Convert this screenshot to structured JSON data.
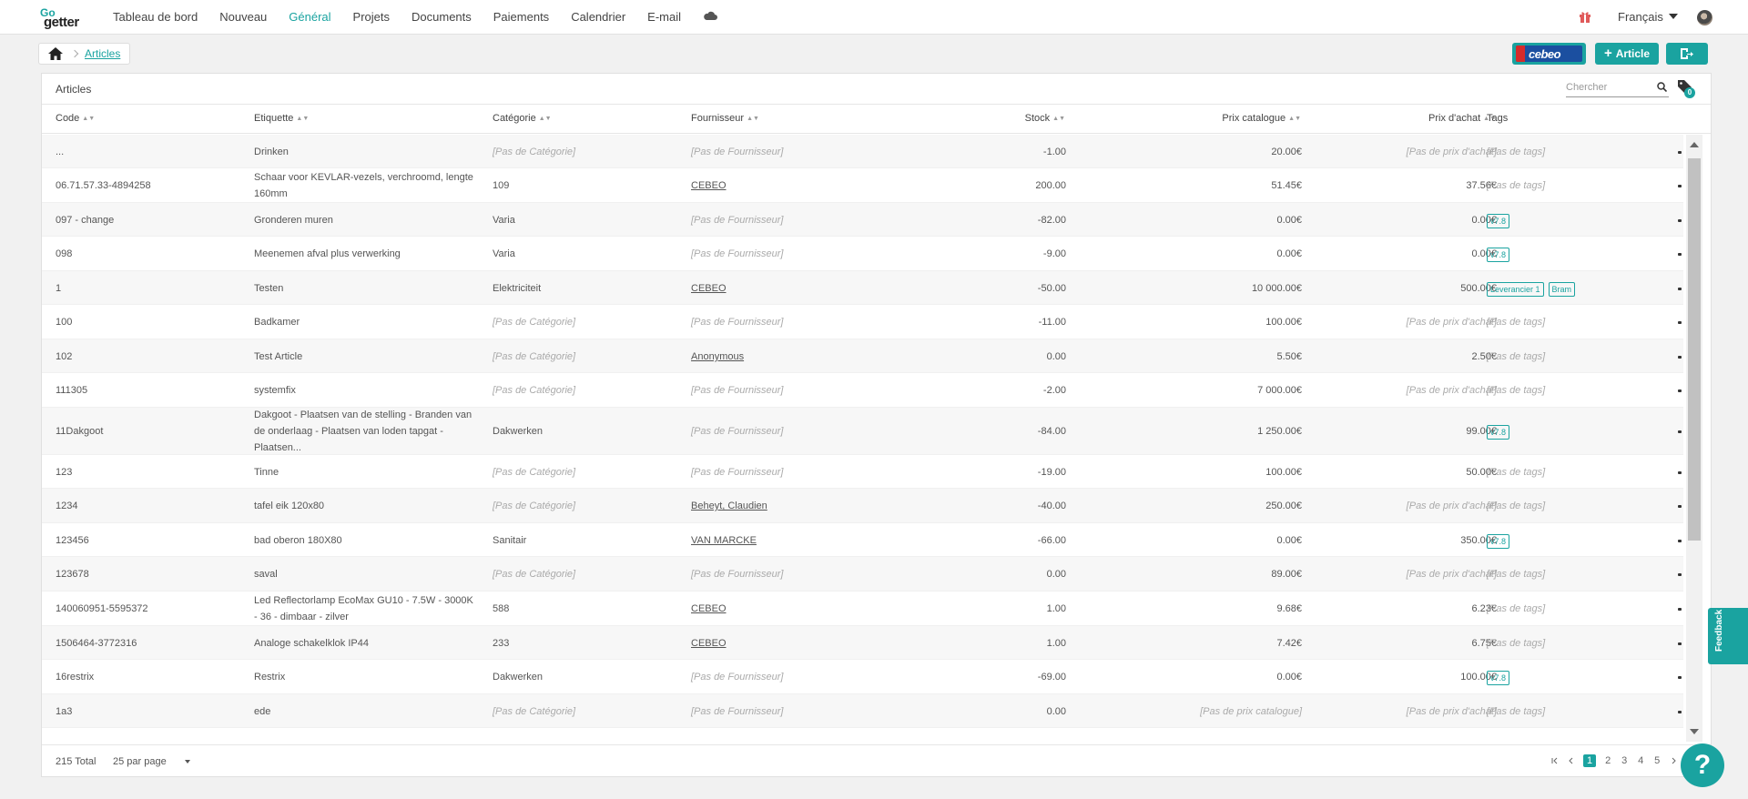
{
  "app": {
    "logo_top": "Go",
    "logo_bottom": "getter"
  },
  "nav": {
    "items": [
      "Tableau de bord",
      "Nouveau",
      "Général",
      "Projets",
      "Documents",
      "Paiements",
      "Calendrier",
      "E-mail"
    ],
    "active": "Général",
    "language": "Français"
  },
  "breadcrumb": {
    "current": "Articles"
  },
  "toolbar": {
    "cebeo_label": "cebeo",
    "add_article_label": "Article"
  },
  "panel": {
    "title": "Articles",
    "search_placeholder": "Chercher",
    "tag_filter_count": "0"
  },
  "table": {
    "columns": {
      "code": "Code",
      "label": "Etiquette",
      "category": "Catégorie",
      "supplier": "Fournisseur",
      "stock": "Stock",
      "catalog_price": "Prix catalogue",
      "purchase_price": "Prix d'achat",
      "tags": "Tags"
    },
    "rows": [
      {
        "code": "...",
        "label": "Drinken",
        "category": "[Pas de Catégorie]",
        "supplier": "[Pas de Fournisseur]",
        "stock": "-1.00",
        "catalog_price": "20.00€",
        "purchase_price": "[Pas de prix d'achat]",
        "tags": [],
        "no_tags": "[Pas de tags]"
      },
      {
        "code": "06.71.57.33-4894258",
        "label": "Schaar voor KEVLAR-vezels, verchroomd, lengte 160mm",
        "category": "109",
        "supplier": "CEBEO",
        "stock": "200.00",
        "catalog_price": "51.45€",
        "purchase_price": "37.56€",
        "tags": [],
        "no_tags": "[Pas de tags]"
      },
      {
        "code": "097 - change",
        "label": "Gronderen muren",
        "category": "Varia",
        "supplier": "[Pas de Fournisseur]",
        "stock": "-82.00",
        "catalog_price": "0.00€",
        "purchase_price": "0.00€",
        "tags": [
          "v7.8"
        ],
        "no_tags": ""
      },
      {
        "code": "098",
        "label": "Meenemen afval plus verwerking",
        "category": "Varia",
        "supplier": "[Pas de Fournisseur]",
        "stock": "-9.00",
        "catalog_price": "0.00€",
        "purchase_price": "0.00€",
        "tags": [
          "v7.8"
        ],
        "no_tags": ""
      },
      {
        "code": "1",
        "label": "Testen",
        "category": "Elektriciteit",
        "supplier": "CEBEO",
        "stock": "-50.00",
        "catalog_price": "10 000.00€",
        "purchase_price": "500.00€",
        "tags": [
          "Leverancier 1",
          "Bram"
        ],
        "no_tags": ""
      },
      {
        "code": "100",
        "label": "Badkamer",
        "category": "[Pas de Catégorie]",
        "supplier": "[Pas de Fournisseur]",
        "stock": "-11.00",
        "catalog_price": "100.00€",
        "purchase_price": "[Pas de prix d'achat]",
        "tags": [],
        "no_tags": "[Pas de tags]"
      },
      {
        "code": "102",
        "label": "Test Article",
        "category": "[Pas de Catégorie]",
        "supplier": "Anonymous",
        "stock": "0.00",
        "catalog_price": "5.50€",
        "purchase_price": "2.50€",
        "tags": [],
        "no_tags": "[Pas de tags]"
      },
      {
        "code": "111305",
        "label": "systemfix",
        "category": "[Pas de Catégorie]",
        "supplier": "[Pas de Fournisseur]",
        "stock": "-2.00",
        "catalog_price": "7 000.00€",
        "purchase_price": "[Pas de prix d'achat]",
        "tags": [],
        "no_tags": "[Pas de tags]"
      },
      {
        "code": "11Dakgoot",
        "label": "Dakgoot - Plaatsen van de stelling - Branden van de onderlaag - Plaatsen van loden tapgat - Plaatsen...",
        "category": "Dakwerken",
        "supplier": "[Pas de Fournisseur]",
        "stock": "-84.00",
        "catalog_price": "1 250.00€",
        "purchase_price": "99.00€",
        "tags": [
          "v7.8"
        ],
        "no_tags": ""
      },
      {
        "code": "123",
        "label": "Tinne",
        "category": "[Pas de Catégorie]",
        "supplier": "[Pas de Fournisseur]",
        "stock": "-19.00",
        "catalog_price": "100.00€",
        "purchase_price": "50.00€",
        "tags": [],
        "no_tags": "[Pas de tags]"
      },
      {
        "code": "1234",
        "label": "tafel eik 120x80",
        "category": "[Pas de Catégorie]",
        "supplier": "Beheyt, Claudien",
        "stock": "-40.00",
        "catalog_price": "250.00€",
        "purchase_price": "[Pas de prix d'achat]",
        "tags": [],
        "no_tags": "[Pas de tags]"
      },
      {
        "code": "123456",
        "label": "bad oberon 180X80",
        "category": "Sanitair",
        "supplier": "VAN MARCKE",
        "stock": "-66.00",
        "catalog_price": "0.00€",
        "purchase_price": "350.00€",
        "tags": [
          "v7.8"
        ],
        "no_tags": ""
      },
      {
        "code": "123678",
        "label": "saval",
        "category": "[Pas de Catégorie]",
        "supplier": "[Pas de Fournisseur]",
        "stock": "0.00",
        "catalog_price": "89.00€",
        "purchase_price": "[Pas de prix d'achat]",
        "tags": [],
        "no_tags": "[Pas de tags]"
      },
      {
        "code": "140060951-5595372",
        "label": "Led Reflectorlamp EcoMax GU10 - 7.5W - 3000K - 36 - dimbaar - zilver",
        "category": "588",
        "supplier": "CEBEO",
        "stock": "1.00",
        "catalog_price": "9.68€",
        "purchase_price": "6.23€",
        "tags": [],
        "no_tags": "[Pas de tags]"
      },
      {
        "code": "1506464-3772316",
        "label": "Analoge schakelklok IP44",
        "category": "233",
        "supplier": "CEBEO",
        "stock": "1.00",
        "catalog_price": "7.42€",
        "purchase_price": "6.75€",
        "tags": [],
        "no_tags": "[Pas de tags]"
      },
      {
        "code": "16restrix",
        "label": "Restrix",
        "category": "Dakwerken",
        "supplier": "[Pas de Fournisseur]",
        "stock": "-69.00",
        "catalog_price": "0.00€",
        "purchase_price": "100.00€",
        "tags": [
          "v7.8"
        ],
        "no_tags": ""
      },
      {
        "code": "1a3",
        "label": "ede",
        "category": "[Pas de Catégorie]",
        "supplier": "[Pas de Fournisseur]",
        "stock": "0.00",
        "catalog_price": "[Pas de prix catalogue]",
        "purchase_price": "[Pas de prix d'achat]",
        "tags": [],
        "no_tags": "[Pas de tags]"
      }
    ]
  },
  "footer": {
    "total": "215 Total",
    "per_page": "25 par page",
    "pages": [
      "1",
      "2",
      "3",
      "4",
      "5"
    ],
    "active_page": "1"
  },
  "feedback_label": "Feedback",
  "help_label": "?",
  "colors": {
    "accent": "#1aa3a0"
  }
}
